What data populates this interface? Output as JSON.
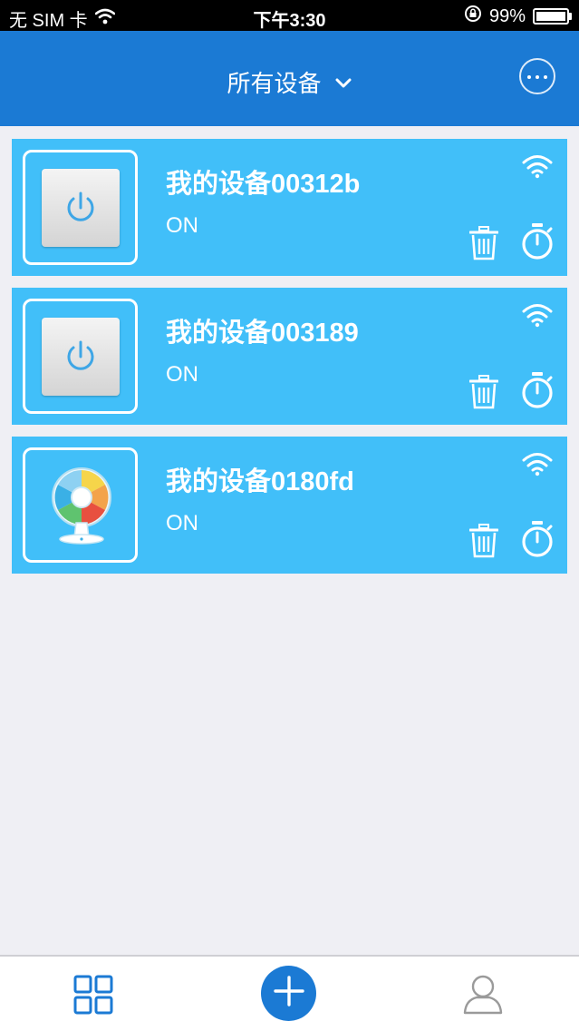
{
  "status_bar": {
    "carrier": "无 SIM 卡",
    "time": "下午3:30",
    "battery_text": "99%",
    "battery_level": 0.99
  },
  "header": {
    "title": "所有设备",
    "title_icon": "chevron-down-icon",
    "more_icon": "more-dots-icon"
  },
  "devices": [
    {
      "name": "我的设备00312b",
      "status": "ON",
      "icon": "power-switch-icon"
    },
    {
      "name": "我的设备003189",
      "status": "ON",
      "icon": "power-switch-icon"
    },
    {
      "name": "我的设备0180fd",
      "status": "ON",
      "icon": "fan-icon"
    }
  ],
  "tab_bar": {
    "items": [
      "grid-icon",
      "add-icon",
      "profile-icon"
    ]
  },
  "colors": {
    "header": "#1b7ad4",
    "card": "#41bff9",
    "background": "#efeff4",
    "accent": "#1b7ad4"
  }
}
